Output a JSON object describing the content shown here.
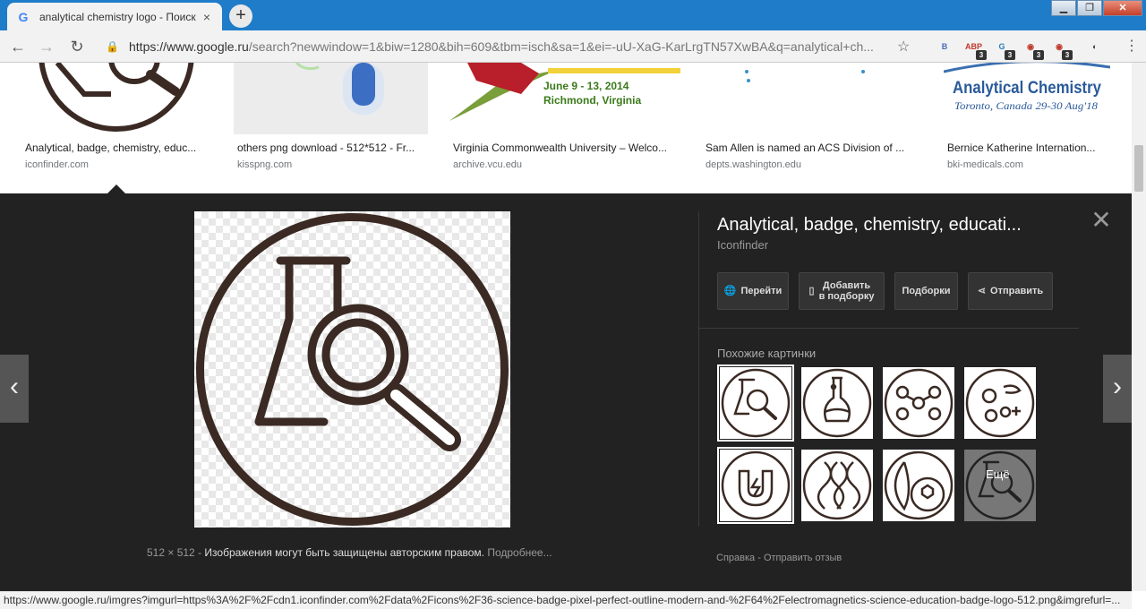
{
  "browser": {
    "tab_title": "analytical chemistry logo - Поиск",
    "tab_close": "×",
    "new_tab": "+",
    "url_host": "https://www.google.ru",
    "url_rest": "/search?newwindow=1&biw=1280&bih=609&tbm=isch&sa=1&ei=-uU-XaG-KarLrgTN57XwBA&q=analytical+ch...",
    "window_buttons": [
      "▁",
      "❐",
      "✕"
    ],
    "extensions": [
      {
        "label": "B",
        "badge": "",
        "color": "#4a69bd"
      },
      {
        "label": "ABP",
        "badge": "3",
        "color": "#c0392b"
      },
      {
        "label": "G",
        "badge": "3",
        "color": "#2980b9"
      },
      {
        "label": "◉",
        "badge": "3",
        "color": "#c0392b"
      },
      {
        "label": "◉",
        "badge": "3",
        "color": "#c0392b"
      },
      {
        "label": "◐",
        "badge": "",
        "color": "#333333"
      }
    ]
  },
  "results_row": [
    {
      "caption": "Analytical, badge, chemistry, educ...",
      "source": "iconfinder.com"
    },
    {
      "caption": "others png download - 512*512 - Fr...",
      "source": "kisspng.com"
    },
    {
      "caption": "Virginia Commonwealth University – Welco...",
      "source": "archive.vcu.edu",
      "image_text": [
        "June 9 - 13, 2014",
        "Richmond, Virginia"
      ]
    },
    {
      "caption": "Sam Allen is named an ACS Division of ...",
      "source": "depts.washington.edu"
    },
    {
      "caption": "Bernice Katherine Internation...",
      "source": "bki-medicals.com",
      "image_text": [
        "Analytical Chemistry",
        "Toronto, Canada  29-30 Aug'18"
      ]
    }
  ],
  "viewer": {
    "title": "Analytical, badge, chemistry, educati...",
    "site": "Iconfinder",
    "size": "512 × 512",
    "sep": "-",
    "copyright": "Изображения могут быть защищены авторским правом.",
    "more_link": "Подробнее...",
    "actions": {
      "visit": "Перейти",
      "save_line1": "Добавить",
      "save_line2": "в подборку",
      "collections": "Подборки",
      "share": "Отправить"
    },
    "similar_label": "Похожие картинки",
    "more_label": "Ещё",
    "help_link": "Справка",
    "feedback_link": "Отправить отзыв",
    "icon_color": "#3a2a23"
  },
  "status_url": "https://www.google.ru/imgres?imgurl=https%3A%2F%2Fcdn1.iconfinder.com%2Fdata%2Ficons%2F36-science-badge-pixel-perfect-outline-modern-and-%2F64%2Felectromagnetics-science-education-badge-logo-512.png&imgrefurl=..."
}
